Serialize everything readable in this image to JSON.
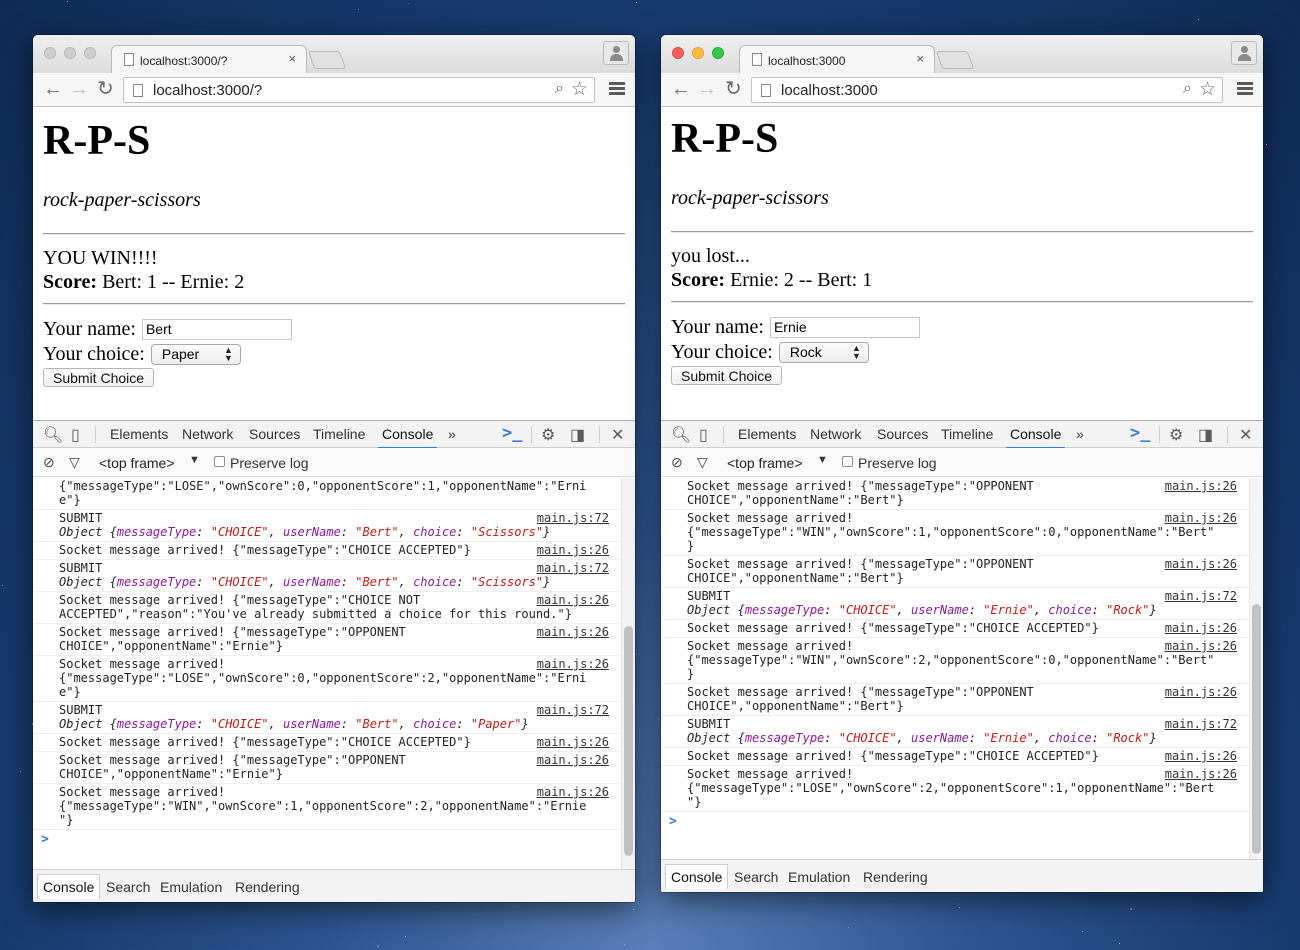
{
  "windows": [
    {
      "id": "left",
      "tab_title": "localhost:3000/?",
      "tab_close": "×",
      "url": "localhost:3000/?",
      "page": {
        "title": "R-P-S",
        "subtitle": "rock-paper-scissors",
        "result": "YOU WIN!!!!",
        "score_label": "Score:",
        "score_text": "Bert: 1 -- Ernie: 2",
        "name_label": "Your name:",
        "name_value": "Bert",
        "choice_label": "Your choice:",
        "choice_value": "Paper",
        "submit_label": "Submit Choice"
      },
      "devtools": {
        "tabs": [
          "Elements",
          "Network",
          "Sources",
          "Timeline",
          "Console"
        ],
        "active_tab": "Console",
        "more": "»",
        "frame": "<top frame>",
        "preserve_log": "Preserve log",
        "drawer_tabs": [
          "Console",
          "Search",
          "Emulation",
          "Rendering"
        ],
        "prompt": ">",
        "messages": [
          {
            "lines": [
              "{\"messageType\":\"LOSE\",\"ownScore\":0,\"opponentScore\":1,\"opponentName\":\"Erni",
              "e\"}"
            ],
            "src": ""
          },
          {
            "lines": [
              "SUBMIT"
            ],
            "obj": {
              "userName": "Bert",
              "choice": "Scissors"
            },
            "src": "main.js:72"
          },
          {
            "lines": [
              "Socket message arrived! {\"messageType\":\"CHOICE ACCEPTED\"}"
            ],
            "src": "main.js:26"
          },
          {
            "lines": [
              "SUBMIT"
            ],
            "obj": {
              "userName": "Bert",
              "choice": "Scissors"
            },
            "src": "main.js:72"
          },
          {
            "lines": [
              "Socket message arrived! {\"messageType\":\"CHOICE NOT",
              "ACCEPTED\",\"reason\":\"You've already submitted a choice for this round.\"}"
            ],
            "src": "main.js:26"
          },
          {
            "lines": [
              "Socket message arrived! {\"messageType\":\"OPPONENT",
              "CHOICE\",\"opponentName\":\"Ernie\"}"
            ],
            "src": "main.js:26"
          },
          {
            "lines": [
              "Socket message arrived!",
              "{\"messageType\":\"LOSE\",\"ownScore\":0,\"opponentScore\":2,\"opponentName\":\"Erni",
              "e\"}"
            ],
            "src": "main.js:26"
          },
          {
            "lines": [
              "SUBMIT"
            ],
            "obj": {
              "userName": "Bert",
              "choice": "Paper"
            },
            "src": "main.js:72"
          },
          {
            "lines": [
              "Socket message arrived! {\"messageType\":\"CHOICE ACCEPTED\"}"
            ],
            "src": "main.js:26"
          },
          {
            "lines": [
              "Socket message arrived! {\"messageType\":\"OPPONENT",
              "CHOICE\",\"opponentName\":\"Ernie\"}"
            ],
            "src": "main.js:26"
          },
          {
            "lines": [
              "Socket message arrived!",
              "{\"messageType\":\"WIN\",\"ownScore\":1,\"opponentScore\":2,\"opponentName\":\"Ernie",
              "\"}"
            ],
            "src": "main.js:26"
          }
        ]
      }
    },
    {
      "id": "right",
      "tab_title": "localhost:3000",
      "tab_close": "×",
      "url": "localhost:3000",
      "page": {
        "title": "R-P-S",
        "subtitle": "rock-paper-scissors",
        "result": "you lost...",
        "score_label": "Score:",
        "score_text": "Ernie: 2 -- Bert: 1",
        "name_label": "Your name:",
        "name_value": "Ernie",
        "choice_label": "Your choice:",
        "choice_value": "Rock",
        "submit_label": "Submit Choice"
      },
      "devtools": {
        "tabs": [
          "Elements",
          "Network",
          "Sources",
          "Timeline",
          "Console"
        ],
        "active_tab": "Console",
        "more": "»",
        "frame": "<top frame>",
        "preserve_log": "Preserve log",
        "drawer_tabs": [
          "Console",
          "Search",
          "Emulation",
          "Rendering"
        ],
        "prompt": ">",
        "messages": [
          {
            "lines": [
              "Socket message arrived! {\"messageType\":\"OPPONENT",
              "CHOICE\",\"opponentName\":\"Bert\"}"
            ],
            "src": "main.js:26"
          },
          {
            "lines": [
              "Socket message arrived!",
              "{\"messageType\":\"WIN\",\"ownScore\":1,\"opponentScore\":0,\"opponentName\":\"Bert\"",
              "}"
            ],
            "src": "main.js:26"
          },
          {
            "lines": [
              "Socket message arrived! {\"messageType\":\"OPPONENT",
              "CHOICE\",\"opponentName\":\"Bert\"}"
            ],
            "src": "main.js:26"
          },
          {
            "lines": [
              "SUBMIT"
            ],
            "obj": {
              "userName": "Ernie",
              "choice": "Rock"
            },
            "src": "main.js:72"
          },
          {
            "lines": [
              "Socket message arrived! {\"messageType\":\"CHOICE ACCEPTED\"}"
            ],
            "src": "main.js:26"
          },
          {
            "lines": [
              "Socket message arrived!",
              "{\"messageType\":\"WIN\",\"ownScore\":2,\"opponentScore\":0,\"opponentName\":\"Bert\"",
              "}"
            ],
            "src": "main.js:26"
          },
          {
            "lines": [
              "Socket message arrived! {\"messageType\":\"OPPONENT",
              "CHOICE\",\"opponentName\":\"Bert\"}"
            ],
            "src": "main.js:26"
          },
          {
            "lines": [
              "SUBMIT"
            ],
            "obj": {
              "userName": "Ernie",
              "choice": "Rock"
            },
            "src": "main.js:72"
          },
          {
            "lines": [
              "Socket message arrived! {\"messageType\":\"CHOICE ACCEPTED\"}"
            ],
            "src": "main.js:26"
          },
          {
            "lines": [
              "Socket message arrived!",
              "{\"messageType\":\"LOSE\",\"ownScore\":2,\"opponentScore\":1,\"opponentName\":\"Bert",
              "\"}"
            ],
            "src": "main.js:26"
          }
        ]
      }
    }
  ],
  "object_log": {
    "prefix": "Object",
    "message_type_key": "messageType",
    "message_type_value": "CHOICE",
    "username_key": "userName",
    "choice_key": "choice"
  }
}
